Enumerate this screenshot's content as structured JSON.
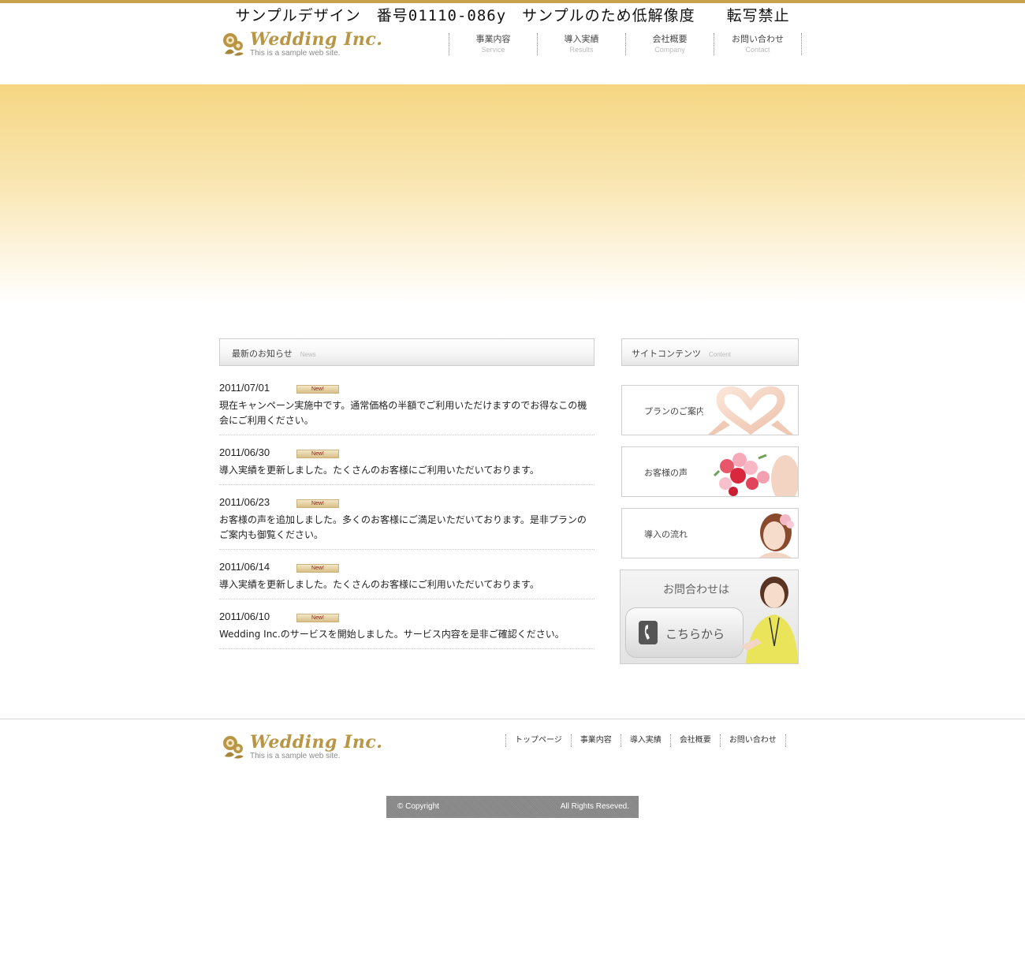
{
  "watermark": "サンプルデザイン　番号01110-086y　サンプルのため低解像度　　転写禁止",
  "brand": {
    "name": "Wedding Inc.",
    "tagline": "This is a sample web site."
  },
  "nav": [
    {
      "label": "事業内容",
      "sub": "Service"
    },
    {
      "label": "導入実績",
      "sub": "Results"
    },
    {
      "label": "会社概要",
      "sub": "Company"
    },
    {
      "label": "お問い合わせ",
      "sub": "Contact"
    }
  ],
  "news": {
    "title": "最新のお知らせ",
    "subtitle": "News",
    "badge": "New!",
    "items": [
      {
        "date": "2011/07/01",
        "text": "現在キャンペーン実施中です。通常価格の半額でご利用いただけますのでお得なこの機会にご利用ください。"
      },
      {
        "date": "2011/06/30",
        "text": "導入実績を更新しました。たくさんのお客様にご利用いただいております。"
      },
      {
        "date": "2011/06/23",
        "text": "お客様の声を追加しました。多くのお客様にご満足いただいております。是非プランのご案内も御覧ください。"
      },
      {
        "date": "2011/06/14",
        "text": "導入実績を更新しました。たくさんのお客様にご利用いただいております。"
      },
      {
        "date": "2011/06/10",
        "text": "Wedding Inc.のサービスを開始しました。サービス内容を是非ご確認ください。"
      }
    ]
  },
  "side": {
    "title": "サイトコンテンツ",
    "subtitle": "Content",
    "cards": [
      {
        "label": "プランのご案内",
        "icon": "heart-hands-image"
      },
      {
        "label": "お客様の声",
        "icon": "bouquet-image"
      },
      {
        "label": "導入の流れ",
        "icon": "bride-image"
      }
    ],
    "contact": {
      "title": "お問合わせは",
      "button": "こちらから",
      "icon": "phone-icon"
    }
  },
  "footer": {
    "nav": [
      "トップページ",
      "事業内容",
      "導入実績",
      "会社概要",
      "お問い合わせ"
    ],
    "copyright": "© Copyright",
    "rights": "All Rights Reseved."
  },
  "colors": {
    "accent": "#c8a24a",
    "brand": "#b89645",
    "hero_top": "#f5d682",
    "copy_bar": "#8b8b8b"
  }
}
